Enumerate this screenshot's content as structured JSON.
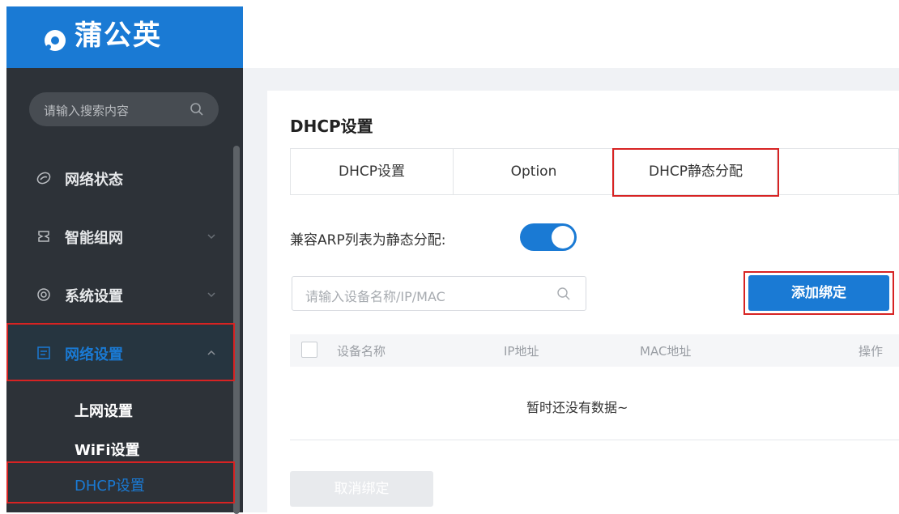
{
  "colors": {
    "sidebar_bg": "#2d3238",
    "brand_blue": "#1a7ad4",
    "highlight_red": "#d72323"
  },
  "logo": {
    "text": "蒲公英",
    "icon": "dandelion-logo-icon"
  },
  "sidebar": {
    "search": {
      "placeholder": "请输入搜索内容",
      "icon": "search-icon"
    },
    "menu": [
      {
        "label": "网络状态",
        "icon": "globe-icon"
      },
      {
        "label": "智能组网",
        "icon": "network-icon",
        "expandable": true
      },
      {
        "label": "系统设置",
        "icon": "gear-icon",
        "expandable": true
      },
      {
        "label": "网络设置",
        "icon": "document-icon",
        "expanded": true,
        "active": true
      }
    ],
    "submenu": [
      {
        "label": "上网设置"
      },
      {
        "label": "WiFi设置"
      },
      {
        "label": "DHCP设置",
        "active": true
      }
    ]
  },
  "main": {
    "title": "DHCP设置",
    "tabs": [
      {
        "label": "DHCP设置"
      },
      {
        "label": "Option"
      },
      {
        "label": "DHCP静态分配",
        "active": true
      }
    ],
    "arp": {
      "label": "兼容ARP列表为静态分配:",
      "enabled": true
    },
    "filter": {
      "placeholder": "请输入设备名称/IP/MAC",
      "icon": "search-icon"
    },
    "add_button": "添加绑定",
    "table": {
      "columns": [
        "设备名称",
        "IP地址",
        "MAC地址",
        "操作"
      ],
      "empty": "暂时还没有数据~"
    },
    "unbind_button": "取消绑定"
  }
}
